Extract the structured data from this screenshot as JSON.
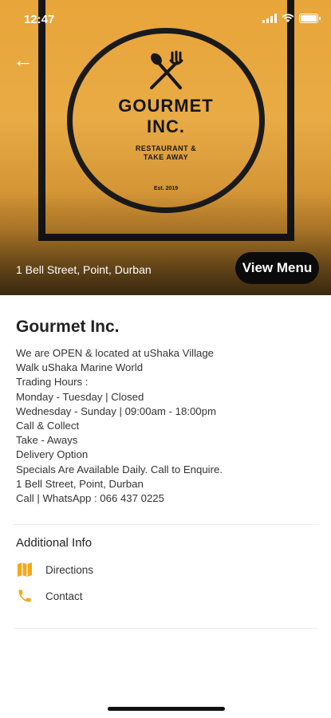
{
  "status_bar": {
    "time": "12:47"
  },
  "hero": {
    "logo": {
      "name_line1": "GOURMET",
      "name_line2": "INC.",
      "tagline_line1": "RESTAURANT &",
      "tagline_line2": "TAKE AWAY",
      "est": "Est. 2019"
    },
    "address": "1 Bell Street, Point, Durban",
    "view_menu_label": "View Menu",
    "back_icon": "arrow-left-icon"
  },
  "business": {
    "title": "Gourmet Inc.",
    "description_lines": [
      "We are OPEN & located at uShaka Village",
      "Walk uShaka Marine World",
      "Trading Hours :",
      "Monday - Tuesday | Closed",
      "Wednesday - Sunday | 09:00am - 18:00pm",
      "Call & Collect",
      "Take - Aways",
      "Delivery Option",
      "Specials Are Available Daily.  Call to Enquire.",
      "1 Bell Street, Point, Durban",
      "Call | WhatsApp : 066 437 0225"
    ]
  },
  "additional_info": {
    "heading": "Additional Info",
    "items": [
      {
        "label": "Directions",
        "icon": "map-icon"
      },
      {
        "label": "Contact",
        "icon": "phone-icon"
      }
    ]
  },
  "colors": {
    "accent": "#f2a91d",
    "hero_bg": "#e9a843",
    "button_bg": "#0b0b0b"
  }
}
